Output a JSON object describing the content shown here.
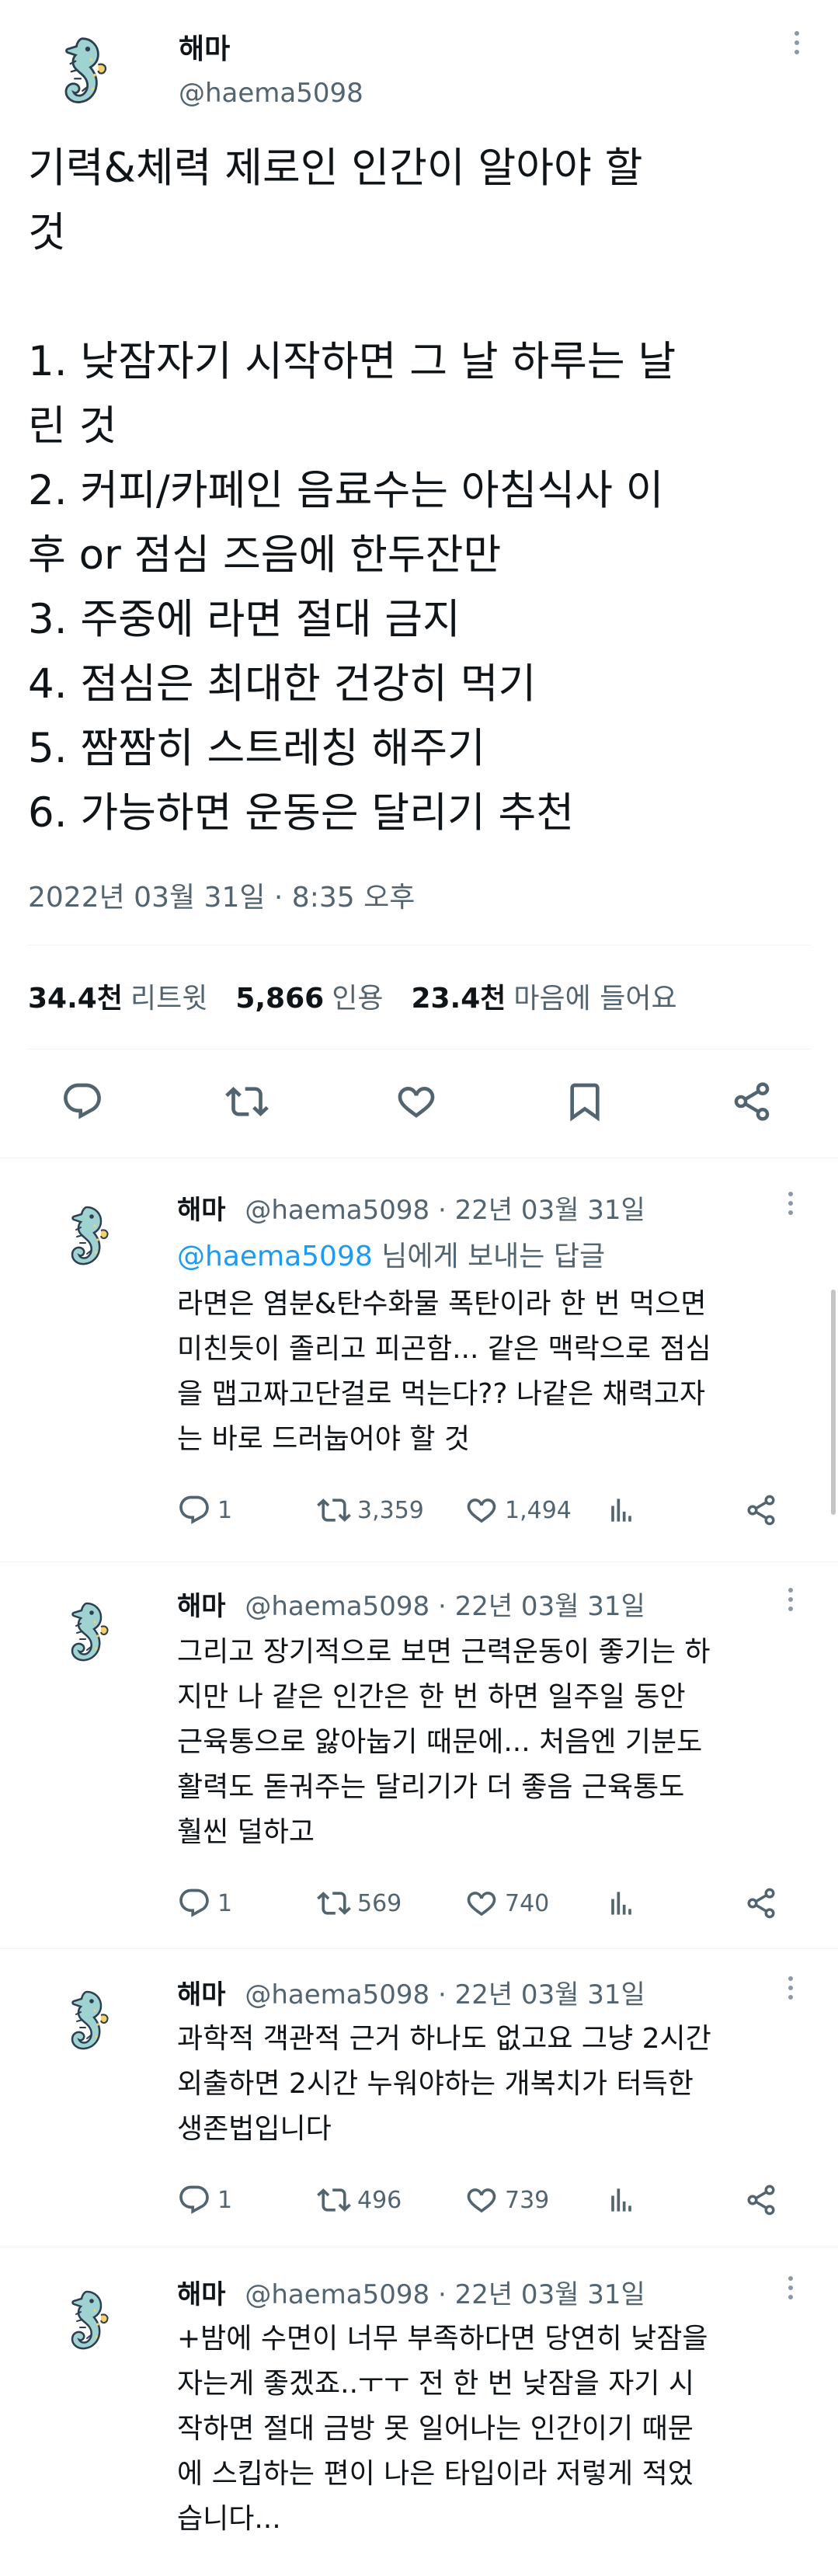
{
  "main_tweet": {
    "display_name": "해마",
    "handle": "@haema5098",
    "body": "기력&체력 제로인 인간이 알아야 할\n것\n\n1. 낮잠자기 시작하면 그 날 하루는 날\n린 것\n2. 커피/카페인 음료수는 아침식사 이\n후 or 점심 즈음에 한두잔만\n3. 주중에 라면 절대 금지\n4. 점심은 최대한 건강히 먹기\n5. 짬짬히 스트레칭 해주기\n6. 가능하면 운동은 달리기 추천",
    "timestamp": "2022년 03월 31일 · 8:35 오후",
    "stats": [
      {
        "num": "34.4천",
        "label": "리트윗"
      },
      {
        "num": "5,866",
        "label": "인용"
      },
      {
        "num": "23.4천",
        "label": "마음에 들어요"
      }
    ]
  },
  "replies": [
    {
      "display_name": "해마",
      "meta": "@haema5098 · 22년 03월 31일",
      "reply_to_handle": "@haema5098",
      "reply_to_suffix": " 님에게 보내는 답글",
      "body": "라면은 염분&탄수화물 폭탄이라 한 번 먹으면\n미친듯이 졸리고 피곤함... 같은 맥락으로 점심\n을 맵고짜고단걸로 먹는다?? 나같은 채력고자\n는 바로 드러눕어야 할 것",
      "replies": "1",
      "retweets": "3,359",
      "likes": "1,494"
    },
    {
      "display_name": "해마",
      "meta": "@haema5098 · 22년 03월 31일",
      "body": "그리고 장기적으로 보면 근력운동이 좋기는 하\n지만 나 같은 인간은 한 번 하면 일주일 동안\n근육통으로 앓아눕기 때문에... 처음엔 기분도\n활력도 돋궈주는 달리기가 더 좋음 근육통도\n훨씬 덜하고",
      "replies": "1",
      "retweets": "569",
      "likes": "740"
    },
    {
      "display_name": "해마",
      "meta": "@haema5098 · 22년 03월 31일",
      "body": "과학적 객관적 근거 하나도 없고요 그냥 2시간\n외출하면 2시간 누워야하는 개복치가 터득한\n생존법입니다",
      "replies": "1",
      "retweets": "496",
      "likes": "739"
    },
    {
      "display_name": "해마",
      "meta": "@haema5098 · 22년 03월 31일",
      "body": "+밤에 수면이 너무 부족하다면 당연히 낮잠을\n자는게 좋겠죠..ㅜㅜ 전 한 번 낮잠을 자기 시\n작하면 절대 금방 못 일어나는 인간이기 때문\n에 스킵하는 편이 나은 타입이라 저렇게 적었\n습니다..."
    }
  ],
  "colors": {
    "link": "#1d9bf0",
    "muted": "#536471",
    "text": "#0f1419"
  },
  "icons": [
    "seahorse-avatar",
    "more-icon",
    "reply-icon",
    "retweet-icon",
    "like-icon",
    "bookmark-icon",
    "share-icon",
    "analytics-icon"
  ]
}
